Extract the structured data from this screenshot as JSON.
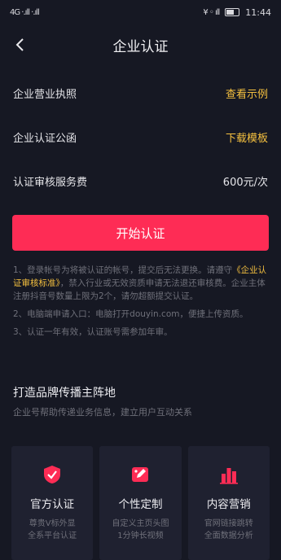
{
  "status_bar": {
    "left": "4G ·.ıll ·.ıll",
    "right": "¥ ◦ ıll",
    "time": "11:44"
  },
  "nav": {
    "title": "企业认证"
  },
  "rows": [
    {
      "label": "企业营业执照",
      "value": "查看示例"
    },
    {
      "label": "企业认证公函",
      "value": "下载模板"
    },
    {
      "label": "认证审核服务费",
      "value": "600元/次"
    }
  ],
  "primary_button": {
    "label": "开始认证"
  },
  "notes": {
    "n1_a": "1、登录帐号为将被认证的帐号，提交后无法更换。请遵守",
    "n1_link": "《企业认证审核标准》",
    "n1_b": "，禁入行业或无效资质申请无法退还审核费。企业主体注册抖音号数量上限为2个，请勿超额提交认证。",
    "n2": "2、电脑端申请入口：电脑打开douyin.com，便捷上传资质。",
    "n3": "3、认证一年有效，认证账号需参加年审。"
  },
  "section": {
    "title": "打造品牌传播主阵地",
    "subtitle": "企业号帮助传递业务信息，建立用户互动关系"
  },
  "cards": [
    {
      "icon": "shield-check-icon",
      "title": "官方认证",
      "desc1": "尊贵V标外显",
      "desc2": "全系平台认证"
    },
    {
      "icon": "pencil-card-icon",
      "title": "个性定制",
      "desc1": "自定义主页头图",
      "desc2": "1分钟长视频"
    },
    {
      "icon": "bar-chart-icon",
      "title": "内容营销",
      "desc1": "官网链接跳转",
      "desc2": "全面数据分析"
    }
  ],
  "colors": {
    "background": "#161823",
    "accent_red": "#fe2c55",
    "link_yellow": "#f5c03f",
    "card_bg": "#1f2130"
  }
}
